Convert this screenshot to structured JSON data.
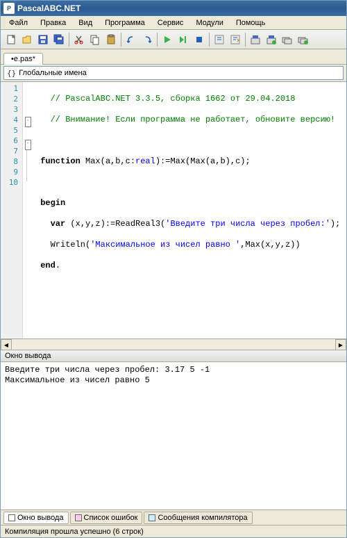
{
  "window": {
    "title": "PascalABC.NET"
  },
  "menu": {
    "file": "Файл",
    "edit": "Правка",
    "view": "Вид",
    "program": "Программа",
    "service": "Сервис",
    "modules": "Модули",
    "help": "Помощь"
  },
  "tab": {
    "label": "•e.pas*"
  },
  "nav": {
    "label": "Глобальные имена"
  },
  "code": {
    "lines": [
      "1",
      "2",
      "3",
      "4",
      "5",
      "6",
      "7",
      "8",
      "9",
      "10"
    ],
    "l1_a": "   // PascalABC.NET 3.3.5, сборка 1662 от 29.04.2018",
    "l2_a": "   // Внимание! Если программа не работает, обновите версию!",
    "l3_a": " ",
    "l4_kw1": "function",
    "l4_mid": " Max(a,b,c:",
    "l4_type": "real",
    "l4_end": "):=Max(Max(a,b),c);",
    "l5_a": " ",
    "l6_kw": "begin",
    "l7_kw": "var",
    "l7_mid": " (x,y,z):=ReadReal3(",
    "l7_str": "'Введите три числа через пробел:'",
    "l7_end": ");",
    "l8_a": "   Writeln(",
    "l8_str": "'Максимальное из чисел равно '",
    "l8_end": ",Max(x,y,z))",
    "l9_kw": "end",
    "l9_end": "."
  },
  "output": {
    "title": "Окно вывода",
    "line1": "Введите три числа через пробел: 3.17 5 -1",
    "line2": "Максимальное из чисел равно 5"
  },
  "bottomTabs": {
    "t1": "Окно вывода",
    "t2": "Список ошибок",
    "t3": "Сообщения компилятора"
  },
  "status": {
    "text": "Компиляция прошла успешно (6 строк)"
  }
}
